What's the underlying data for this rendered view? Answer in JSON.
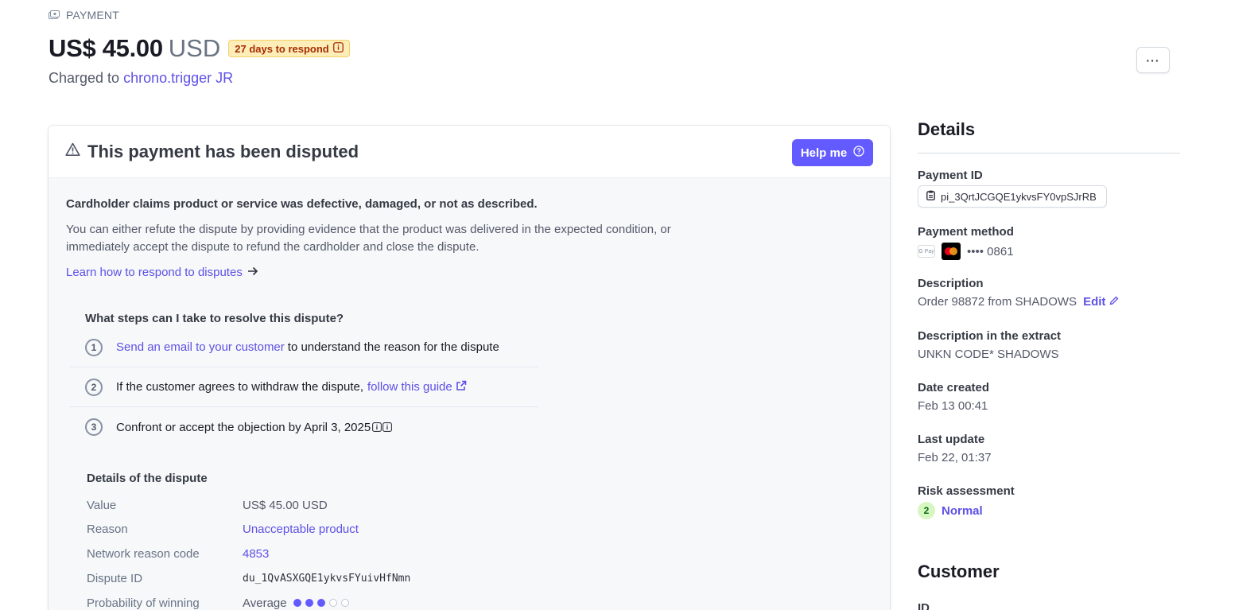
{
  "header": {
    "kicker": "PAYMENT",
    "amount": "US$ 45.00",
    "currency": "USD",
    "respond_badge": "27 days to respond",
    "charged_prefix": "Charged to",
    "customer_name": "chrono.trigger JR",
    "more_label": "···"
  },
  "dispute": {
    "title": "This payment has been disputed",
    "help_label": "Help me",
    "claim": "Cardholder claims product or service was defective, damaged, or not as described.",
    "body": "You can either refute the dispute by providing evidence that the product was delivered in the expected condition, or immediately accept the dispute to refund the cardholder and close the dispute.",
    "learn_link": "Learn how to respond to disputes",
    "steps_title": "What steps can I take to resolve this dispute?",
    "steps": [
      {
        "num": "1",
        "link": "Send an email to your customer",
        "text": "to understand the reason for the dispute"
      },
      {
        "num": "2",
        "text": "If the customer agrees to withdraw the dispute,",
        "link": "follow this guide"
      },
      {
        "num": "3",
        "text": "Confront or accept the objection by April 3, 2025"
      }
    ],
    "details_title": "Details of the dispute",
    "details": [
      {
        "label": "Value",
        "value": "US$ 45.00 USD"
      },
      {
        "label": "Reason",
        "value": "Unacceptable product"
      },
      {
        "label": "Network reason code",
        "value": "4853"
      },
      {
        "label": "Dispute ID",
        "value": "du_1QvASXGQE1ykvsFYuivHfNmn"
      },
      {
        "label": "Probability of winning",
        "value": "Average"
      }
    ],
    "win_probability": {
      "filled": 3,
      "total": 5
    }
  },
  "side": {
    "details_title": "Details",
    "payment_id_label": "Payment ID",
    "payment_id": "pi_3QrtJCGQE1ykvsFY0vpSJrRB",
    "payment_method_label": "Payment method",
    "gpay_label": "G Pay",
    "card_last4": "•••• 0861",
    "description_label": "Description",
    "description": "Order 98872 from SHADOWS",
    "edit_label": "Edit",
    "extract_label": "Description in the extract",
    "extract": "UNKN CODE* SHADOWS",
    "created_label": "Date created",
    "created": "Feb 13 00:41",
    "updated_label": "Last update",
    "updated": "Feb 22, 01:37",
    "risk_label": "Risk assessment",
    "risk_score": "2",
    "risk_level": "Normal",
    "customer_title": "Customer",
    "customer_id_label": "ID"
  },
  "colors": {
    "accent": "#635bff",
    "link": "#5e50e6",
    "warning_bg": "#fcedb9",
    "risk_bg": "#d7f7c2"
  }
}
